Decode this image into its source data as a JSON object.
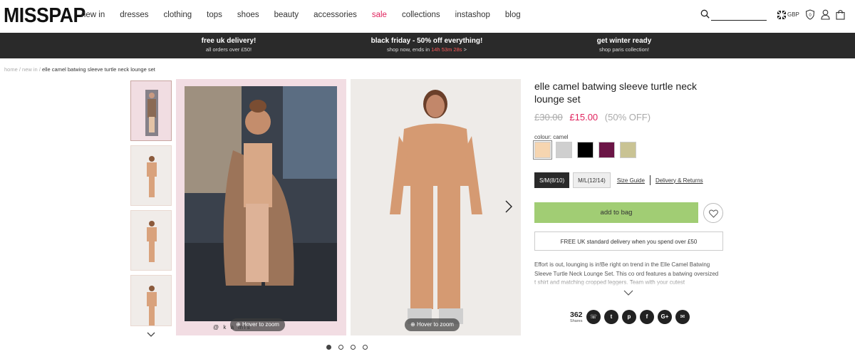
{
  "header": {
    "logo": "MISSPAP",
    "nav": [
      {
        "label": "new in",
        "sale": false
      },
      {
        "label": "dresses",
        "sale": false
      },
      {
        "label": "clothing",
        "sale": false
      },
      {
        "label": "tops",
        "sale": false
      },
      {
        "label": "shoes",
        "sale": false
      },
      {
        "label": "beauty",
        "sale": false
      },
      {
        "label": "accessories",
        "sale": false
      },
      {
        "label": "sale",
        "sale": true
      },
      {
        "label": "collections",
        "sale": false
      },
      {
        "label": "instashop",
        "sale": false
      },
      {
        "label": "blog",
        "sale": false
      }
    ],
    "currency": "GBP",
    "wishlist_count": "0",
    "icons": [
      "search-icon",
      "flag-icon",
      "wishlist-icon",
      "account-icon",
      "bag-icon"
    ]
  },
  "promo": [
    {
      "title": "free uk delivery!",
      "sub": "all orders over £50!"
    },
    {
      "title": "black friday - 50% off everything!",
      "sub_pre": "shop now, ends in ",
      "countdown": "14h 53m 28s",
      "sub_post": " >"
    },
    {
      "title": "get winter ready",
      "sub": "shop paris collection!"
    }
  ],
  "breadcrumb": {
    "home": "home",
    "sep": "/",
    "new_in": "new in",
    "current": "elle camel batwing sleeve turtle neck lounge set"
  },
  "gallery": {
    "watermark": "@ k a   mis",
    "zoom_label": "Hover to zoom",
    "slides": 4,
    "active_slide": 0
  },
  "product": {
    "title": "elle camel batwing sleeve turtle neck lounge set",
    "old_price": "£30.00",
    "new_price": "£15.00",
    "discount": "(50% OFF)",
    "colour_label": "colour: camel",
    "colours": [
      "#f6d5b0",
      "#cfcfcf",
      "#000000",
      "#6b1546",
      "#c9c394"
    ],
    "sizes": [
      {
        "label": "S/M(8/10)",
        "selected": true
      },
      {
        "label": "M/L(12/14)",
        "selected": false
      }
    ],
    "size_guide": "Size Guide",
    "delivery_returns": "Delivery & Returns",
    "add_to_bag": "add to bag",
    "delivery_note": "FREE UK standard delivery when you spend over £50",
    "description": "Effort is out, lounging is in!Be right on trend in the Elle Camel Batwing Sleeve Turtle Neck Lounge Set. This co ord features a batwing oversized t shirt and matching cropped leggers. Team with your cutest",
    "share_count": "362",
    "share_label": "Shares",
    "social": [
      {
        "name": "whatsapp-icon",
        "glyph": "☏"
      },
      {
        "name": "twitter-icon",
        "glyph": "t"
      },
      {
        "name": "pinterest-icon",
        "glyph": "p"
      },
      {
        "name": "facebook-icon",
        "glyph": "f"
      },
      {
        "name": "google-plus-icon",
        "glyph": "G+"
      },
      {
        "name": "email-icon",
        "glyph": "✉"
      }
    ]
  },
  "colors": {
    "accent_pink": "#e0245e",
    "add_to_bag": "#a1cd74",
    "promo_bg": "#2a2a2a"
  }
}
